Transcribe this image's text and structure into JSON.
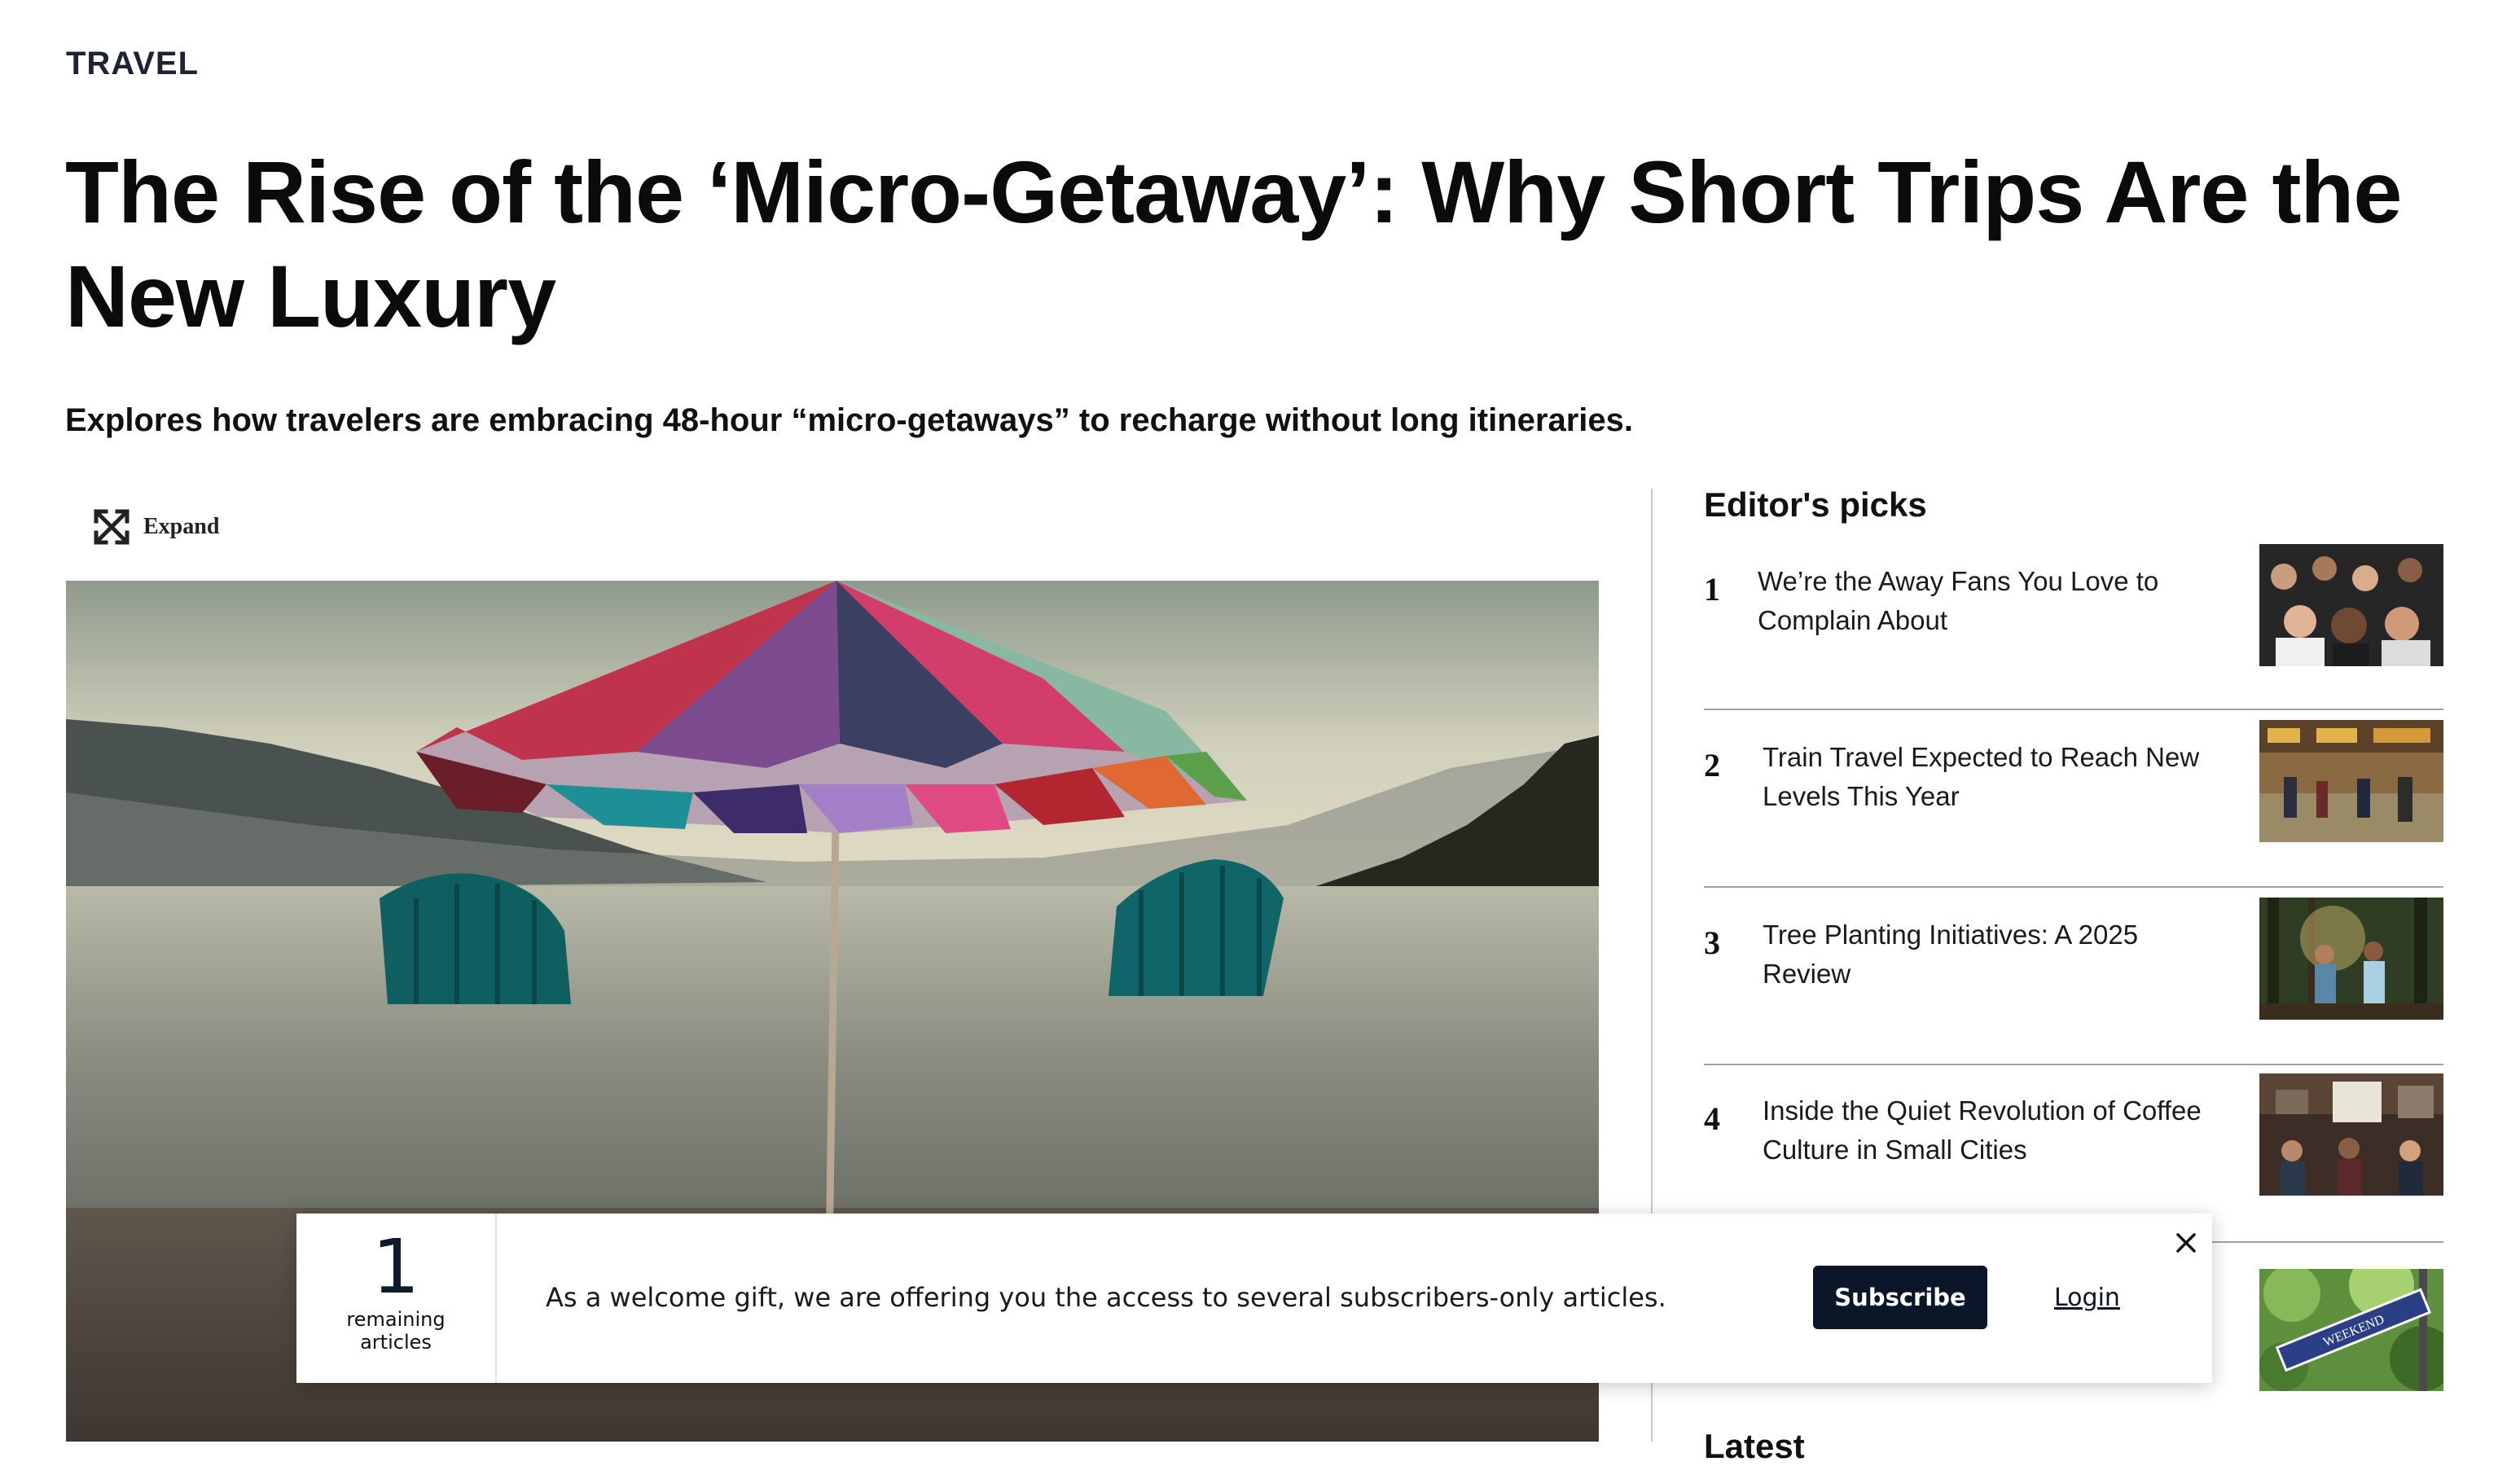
{
  "section": "TRAVEL",
  "article": {
    "title": "The Rise of the ‘Micro-Getaway’: Why Short Trips Are the New Luxury",
    "standfirst": "Explores how travelers are embracing 48-hour “micro-getaways” to recharge without long itineraries.",
    "expand_label": "Expand"
  },
  "sidebar": {
    "title": "Editor's picks",
    "picks": [
      {
        "rank": "1",
        "title": "We’re the Away Fans You Love to Complain About"
      },
      {
        "rank": "2",
        "title": "Train Travel Expected to Reach New Levels This Year"
      },
      {
        "rank": "3",
        "title": "Tree Planting Initiatives: A 2025 Review"
      },
      {
        "rank": "4",
        "title": "Inside the Quiet Revolution of Coffee Culture in Small Cities"
      }
    ],
    "pick5_sign_text": "WEEKEND",
    "latest_title": "Latest"
  },
  "paywall": {
    "remaining_count": "1",
    "remaining_label": "remaining articles",
    "message": "As a welcome gift, we are offering you the access to several subscribers-only articles.",
    "subscribe_label": "Subscribe",
    "login_label": "Login"
  },
  "icons": {
    "expand": "expand-arrows-icon",
    "close": "close-icon"
  },
  "colors": {
    "subscribe_bg": "#0b1628",
    "section_label": "#1c2333",
    "separator": "#9aa3ad"
  }
}
